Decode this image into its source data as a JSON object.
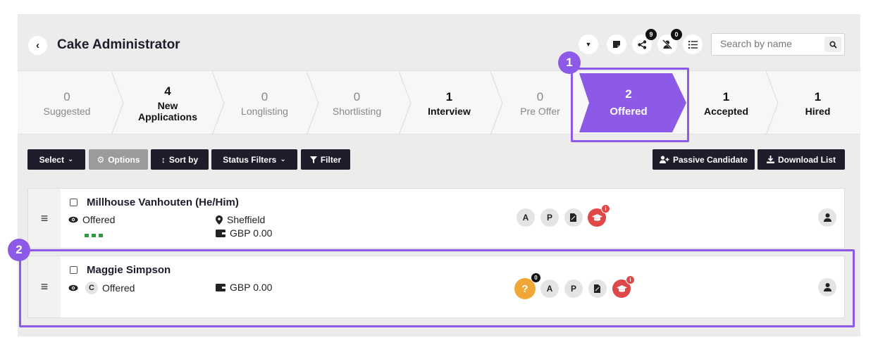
{
  "header": {
    "back_glyph": "‹",
    "title": "Cake Administrator",
    "icons": {
      "dropdown": "chevron-down-icon",
      "notes": "sticky-note-icon",
      "share": "share-icon",
      "share_count": "9",
      "unassigned": "user-slash-icon",
      "unassigned_count": "0",
      "list": "list-icon"
    },
    "search_placeholder": "Search by name"
  },
  "pipeline": [
    {
      "count": "0",
      "label": "Suggested"
    },
    {
      "count": "4",
      "label": "New Applications"
    },
    {
      "count": "0",
      "label": "Longlisting"
    },
    {
      "count": "0",
      "label": "Shortlisting"
    },
    {
      "count": "1",
      "label": "Interview"
    },
    {
      "count": "0",
      "label": "Pre Offer"
    },
    {
      "count": "2",
      "label": "Offered"
    },
    {
      "count": "1",
      "label": "Accepted"
    },
    {
      "count": "1",
      "label": "Hired"
    }
  ],
  "pipeline_new_applications_lines": [
    "New",
    "Applications"
  ],
  "active_stage": "Offered",
  "accent_color": "#8c5ae6",
  "toolbar": {
    "select": "Select",
    "options": "Options",
    "sort_by": "Sort by",
    "status_filters": "Status Filters",
    "filter": "Filter",
    "passive_candidate": "Passive Candidate",
    "download_list": "Download List"
  },
  "candidates": [
    {
      "name": "Millhouse Vanhouten (He/Him)",
      "status": "Offered",
      "location": "Sheffield",
      "salary": "GBP 0.00",
      "badges": [
        "A",
        "P"
      ],
      "progress_steps": 3
    },
    {
      "name": "Maggie Simpson",
      "tag": "C",
      "status": "Offered",
      "salary": "GBP 0.00",
      "question_badge": "?",
      "question_count": "0",
      "badges": [
        "A",
        "P"
      ]
    }
  ],
  "markers": {
    "one": "1",
    "two": "2"
  },
  "alert_badge": "i"
}
